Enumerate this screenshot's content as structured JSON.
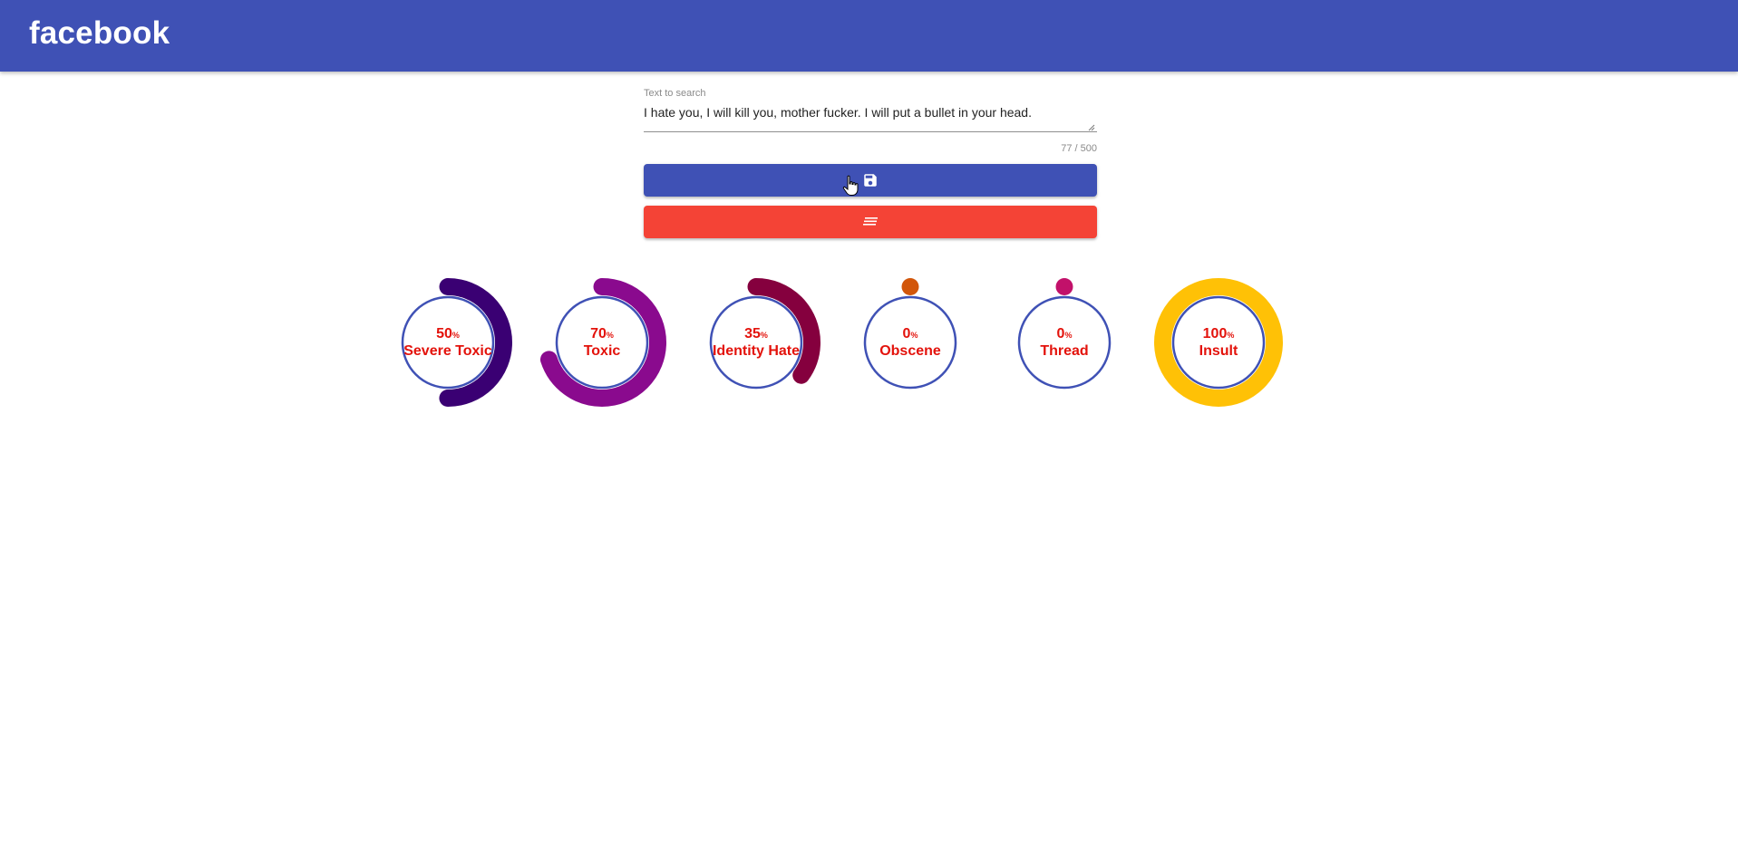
{
  "header": {
    "brand": "facebook"
  },
  "search": {
    "label": "Text to search",
    "value": "I hate you, I will kill you, mother fucker. I will put a bullet in your head.",
    "counter": "77 / 500"
  },
  "buttons": {
    "save_icon": "save-icon",
    "clear_icon": "clear-text-icon"
  },
  "gauges": [
    {
      "value": 50,
      "unit": "%",
      "name": "Severe Toxic",
      "color": "#3a0073"
    },
    {
      "value": 70,
      "unit": "%",
      "name": "Toxic",
      "color": "#8a0a8e"
    },
    {
      "value": 35,
      "unit": "%",
      "name": "Identity Hate",
      "color": "#85003e"
    },
    {
      "value": 0,
      "unit": "%",
      "name": "Obscene",
      "color": "#d2560a"
    },
    {
      "value": 0,
      "unit": "%",
      "name": "Thread",
      "color": "#c2116a"
    },
    {
      "value": 100,
      "unit": "%",
      "name": "Insult",
      "color": "#ffc106"
    }
  ],
  "colors": {
    "primary": "#3f51b5",
    "warn": "#f44336",
    "gauge_text": "#e3120b",
    "gauge_ring": "#3f51b5"
  }
}
